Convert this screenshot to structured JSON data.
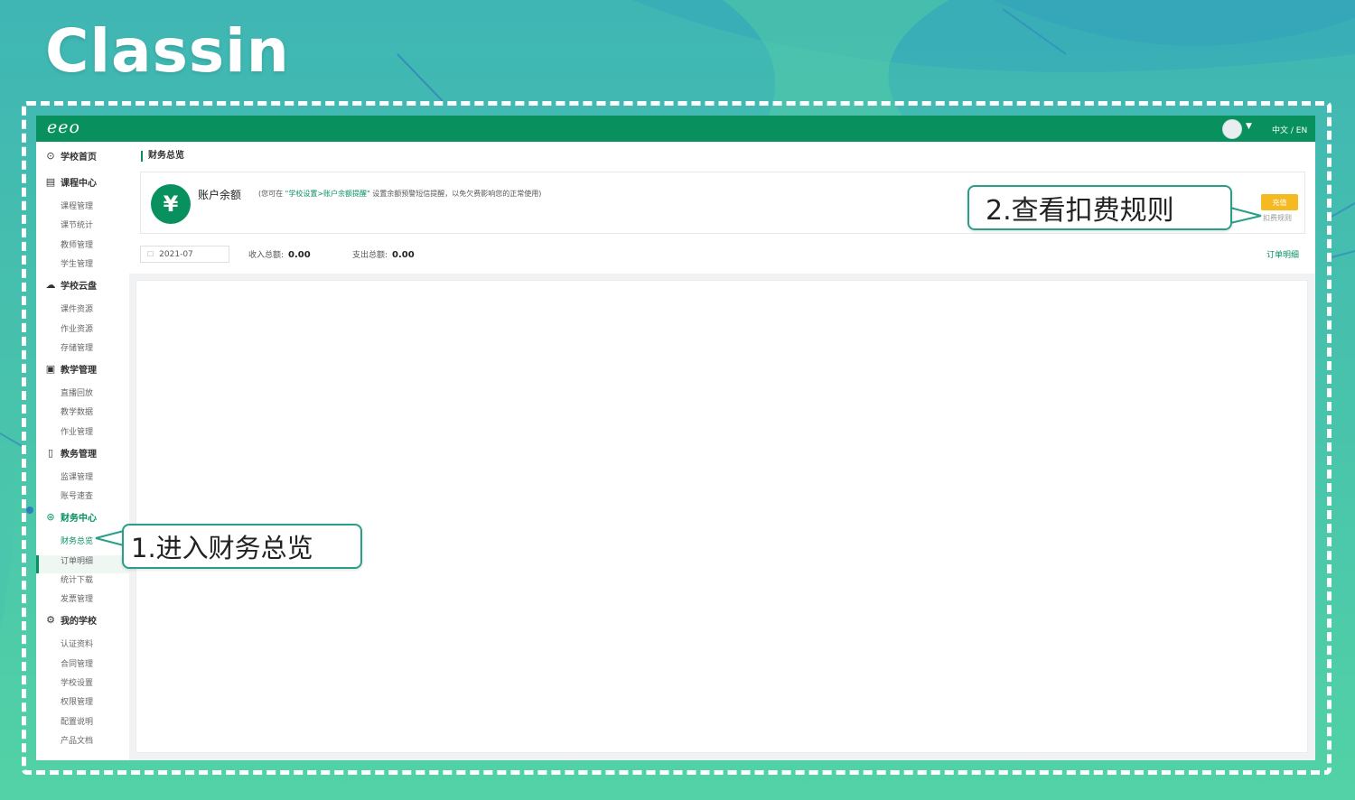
{
  "brand": {
    "logo_text": "Classin"
  },
  "topbar": {
    "logo": "eeo",
    "avatar_icon": "user-avatar",
    "lang": "中文 / EN"
  },
  "sidebar": {
    "groups": [
      {
        "icon": "home-icon",
        "label": "学校首页",
        "items": []
      },
      {
        "icon": "calendar-icon",
        "label": "课程中心",
        "items": [
          "课程管理",
          "课节统计",
          "教师管理",
          "学生管理"
        ]
      },
      {
        "icon": "cloud-icon",
        "label": "学校云盘",
        "items": [
          "课件资源",
          "作业资源",
          "存储管理"
        ]
      },
      {
        "icon": "teaching-icon",
        "label": "教学管理",
        "items": [
          "直播回放",
          "教学数据",
          "作业管理"
        ]
      },
      {
        "icon": "admin-icon",
        "label": "教务管理",
        "items": [
          "监课管理",
          "账号速查"
        ]
      },
      {
        "icon": "finance-icon",
        "label": "财务中心",
        "items": [
          "财务总览",
          "订单明细",
          "统计下载",
          "发票管理"
        ]
      },
      {
        "icon": "school-icon",
        "label": "我的学校",
        "items": [
          "认证资料",
          "合同管理",
          "学校设置",
          "权限管理",
          "配置说明",
          "产品文档"
        ]
      }
    ],
    "active_item": "财务总览"
  },
  "page": {
    "title": "财务总览",
    "balance": {
      "label": "账户余额",
      "note_prefix": "(您可在",
      "note_link": "\"学校设置>账户余额提醒\"",
      "note_suffix": "设置余额预警短信提醒，以免欠费影响您的正常使用)",
      "recharge_label": "充值",
      "rules_label": "扣费规则"
    },
    "filters": {
      "date": "2021-07",
      "income_label": "收入总额:",
      "income_value": "0.00",
      "expense_label": "支出总额:",
      "expense_value": "0.00",
      "order_detail_link": "订单明细"
    }
  },
  "callouts": {
    "step1": "1.进入财务总览",
    "step2": "2.查看扣费规则"
  },
  "colors": {
    "primary": "#08915f",
    "accent": "#f5b921",
    "callout_border": "#2a9e89"
  }
}
